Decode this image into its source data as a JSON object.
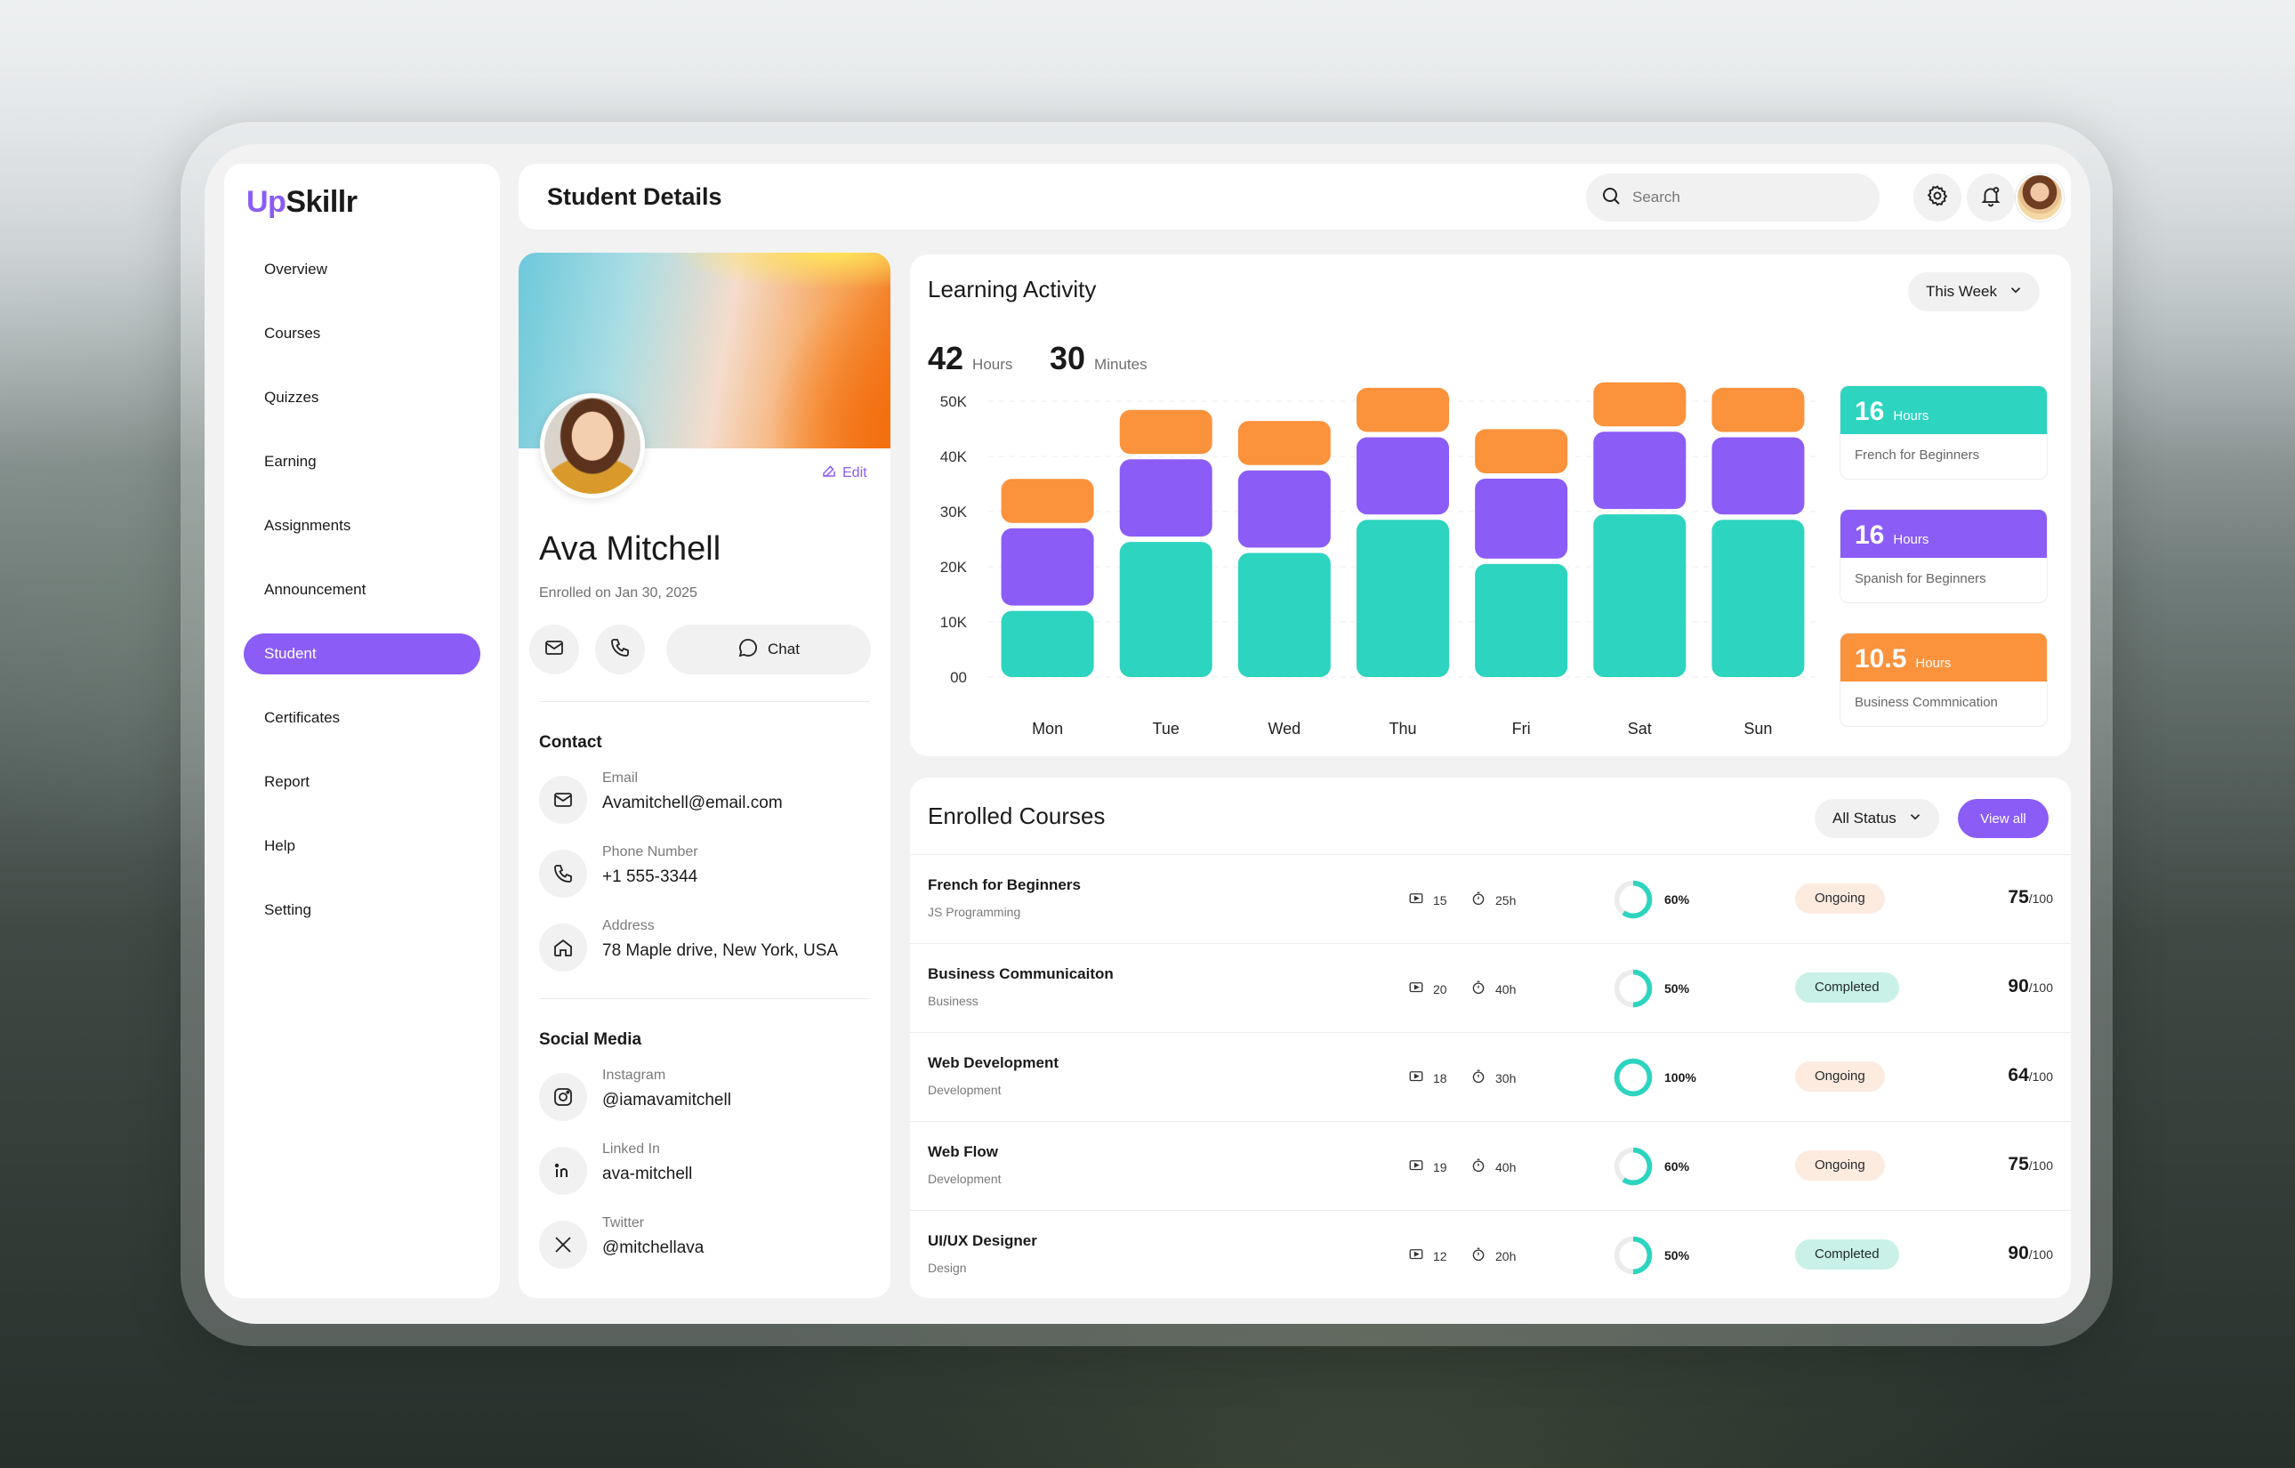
{
  "brand": {
    "prefix": "Up",
    "suffix": "Skillr"
  },
  "sidebar": {
    "items": [
      {
        "label": "Overview"
      },
      {
        "label": "Courses"
      },
      {
        "label": "Quizzes"
      },
      {
        "label": "Earning"
      },
      {
        "label": "Assignments"
      },
      {
        "label": "Announcement"
      },
      {
        "label": "Student"
      },
      {
        "label": "Certificates"
      },
      {
        "label": "Report"
      },
      {
        "label": "Help"
      },
      {
        "label": "Setting"
      }
    ],
    "active": "Student"
  },
  "header": {
    "title": "Student Details",
    "search_placeholder": "Search"
  },
  "profile": {
    "name": "Ava Mitchell",
    "enrolled": "Enrolled on Jan 30, 2025",
    "edit_label": "Edit",
    "chat_label": "Chat",
    "contact_title": "Contact",
    "contact": [
      {
        "label": "Email",
        "value": "Avamitchell@email.com"
      },
      {
        "label": "Phone Number",
        "value": "+1 555-3344"
      },
      {
        "label": "Address",
        "value": "78 Maple drive, New York, USA"
      }
    ],
    "social_title": "Social Media",
    "social": [
      {
        "label": "Instagram",
        "value": "@iamavamitchell"
      },
      {
        "label": "Linked In",
        "value": "ava-mitchell"
      },
      {
        "label": "Twitter",
        "value": "@mitchellava"
      }
    ]
  },
  "activity": {
    "title": "Learning Activity",
    "period": "This Week",
    "total_hours": "42",
    "hours_label": "Hours",
    "total_minutes": "30",
    "minutes_label": "Minutes",
    "colors": {
      "french": "#2dd4bf",
      "spanish": "#8b5cf6",
      "business": "#fb923c"
    },
    "stats": [
      {
        "value": "16",
        "unit": "Hours",
        "label": "French for Beginners",
        "color": "#2dd4bf"
      },
      {
        "value": "16",
        "unit": "Hours",
        "label": "Spanish for Beginners",
        "color": "#8b5cf6"
      },
      {
        "value": "10.5",
        "unit": "Hours",
        "label": "Business Commnication",
        "color": "#fb923c"
      }
    ]
  },
  "chart_data": {
    "type": "bar",
    "stacked": true,
    "categories": [
      "Mon",
      "Tue",
      "Wed",
      "Thu",
      "Fri",
      "Sat",
      "Sun"
    ],
    "series": [
      {
        "values": [
          12000,
          24500,
          22500,
          28500,
          20500,
          29500,
          28500
        ]
      },
      {
        "values": [
          14000,
          14000,
          14000,
          14000,
          14500,
          14000,
          14000
        ]
      },
      {
        "values": [
          8000,
          8000,
          8000,
          8000,
          8000,
          8000,
          8000
        ]
      }
    ],
    "y_ticks": [
      "00",
      "10K",
      "20K",
      "30K",
      "40K",
      "50K"
    ],
    "ylim": [
      0,
      50000
    ],
    "grid": true
  },
  "courses": {
    "title": "Enrolled Courses",
    "filter": "All Status",
    "view_all": "View all",
    "rows": [
      {
        "name": "French for Beginners",
        "category": "JS Programming",
        "lessons": "15",
        "duration": "25h",
        "progress": 60,
        "progress_label": "60%",
        "status": "Ongoing",
        "score": "75",
        "max": "/100"
      },
      {
        "name": "Business Communicaiton",
        "category": "Business",
        "lessons": "20",
        "duration": "40h",
        "progress": 50,
        "progress_label": "50%",
        "status": "Completed",
        "score": "90",
        "max": "/100"
      },
      {
        "name": "Web Development",
        "category": "Development",
        "lessons": "18",
        "duration": "30h",
        "progress": 100,
        "progress_label": "100%",
        "status": "Ongoing",
        "score": "64",
        "max": "/100"
      },
      {
        "name": "Web Flow",
        "category": "Development",
        "lessons": "19",
        "duration": "40h",
        "progress": 60,
        "progress_label": "60%",
        "status": "Ongoing",
        "score": "75",
        "max": "/100"
      },
      {
        "name": "UI/UX Designer",
        "category": "Design",
        "lessons": "12",
        "duration": "20h",
        "progress": 50,
        "progress_label": "50%",
        "status": "Completed",
        "score": "90",
        "max": "/100"
      }
    ]
  }
}
